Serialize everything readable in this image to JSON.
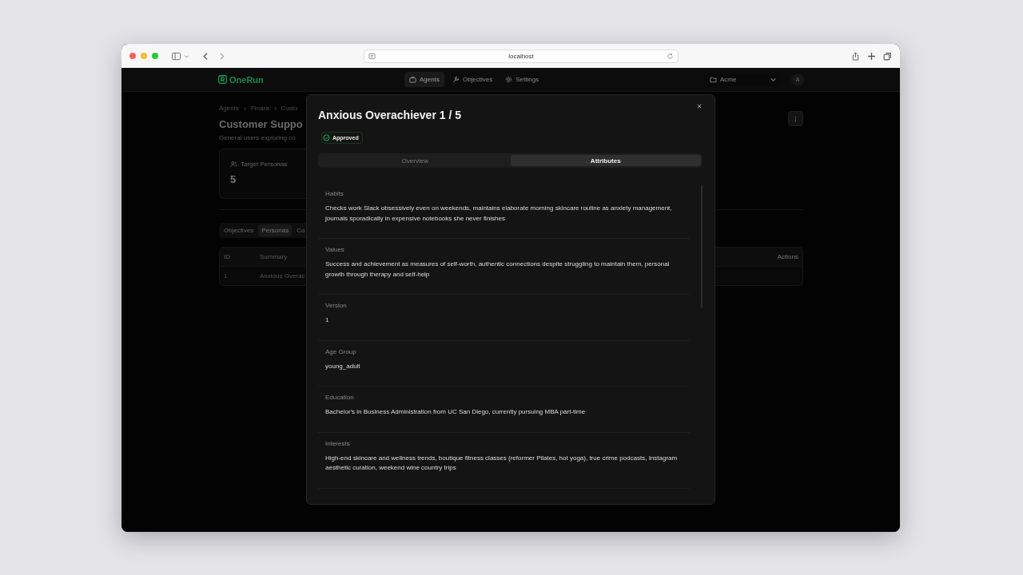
{
  "browser": {
    "url": "localhost"
  },
  "header": {
    "logo": "OneRun",
    "nav": [
      {
        "label": "Agents",
        "selected": true
      },
      {
        "label": "Objectives",
        "selected": false
      },
      {
        "label": "Settings",
        "selected": false
      }
    ],
    "organization": "Acme",
    "avatar": "A"
  },
  "page": {
    "breadcrumb": [
      "Agents",
      "Finara",
      "Custo"
    ],
    "title": "Customer Suppo",
    "subtitle": "General users exploring co",
    "stat": {
      "label": "Target Personas",
      "value": "5"
    },
    "tabs": [
      {
        "label": "Objectives",
        "selected": false
      },
      {
        "label": "Personas",
        "selected": true
      },
      {
        "label": "Co",
        "selected": false
      }
    ],
    "table": {
      "columns": [
        "ID",
        "Summary",
        "Actions"
      ],
      "rows": [
        [
          "1",
          "Anxious Overac"
        ]
      ]
    }
  },
  "modal": {
    "title": "Anxious Overachiever 1 / 5",
    "status": {
      "label": "Approved",
      "kind": "approved"
    },
    "tabs": [
      {
        "label": "Overview",
        "selected": false
      },
      {
        "label": "Attributes",
        "selected": true
      }
    ],
    "attributes": [
      {
        "label": "Habits",
        "value": "Checks work Slack obsessively even on weekends, maintains elaborate morning skincare routine as anxiety management, journals sporadically in expensive notebooks she never finishes"
      },
      {
        "label": "Values",
        "value": "Success and achievement as measures of self-worth, authentic connections despite struggling to maintain them, personal growth through therapy and self-help"
      },
      {
        "label": "Version",
        "value": "1"
      },
      {
        "label": "Age Group",
        "value": "young_adult"
      },
      {
        "label": "Education",
        "value": "Bachelor's in Business Administration from UC San Diego, currently pursuing MBA part-time"
      },
      {
        "label": "Interests",
        "value": "High-end skincare and wellness trends, boutique fitness classes (reformer Pilates, hot yoga), true crime podcasts, Instagram aesthetic curation, weekend wine country trips"
      }
    ]
  }
}
